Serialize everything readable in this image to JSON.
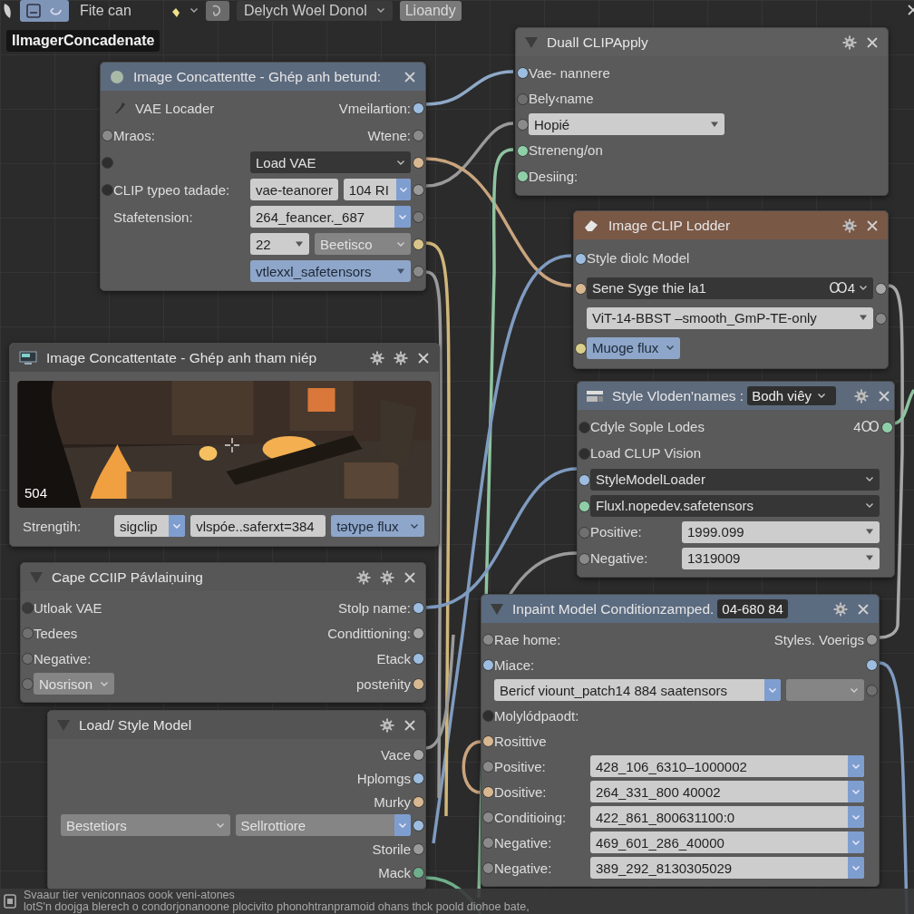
{
  "toolbar": {
    "file_label": "Fite can",
    "dropdown": "Delych Woel Donol",
    "button": "Lioandy"
  },
  "canvas_label": "IlmagerConcadenate",
  "nodes": [
    {
      "title": "Image Concattentte - Ghép anh betund:",
      "color": "#5c6a7e",
      "rows": [
        {
          "kind": "tool",
          "left": "VAE Locader",
          "right": "Vmeilartion:",
          "out": {
            "color": "#9dbde0"
          }
        },
        {
          "kind": "io",
          "left": "Mraos:",
          "right": "Wtene:",
          "in": {
            "color": "#8a8a8a"
          },
          "out": {
            "color": "#8a8a8a"
          }
        },
        {
          "kind": "widgets",
          "widgets": [
            {
              "value": "Load VAE"
            }
          ],
          "in": {
            "color": "#2e2e2e"
          },
          "out": {
            "color": "#d8b891"
          }
        },
        {
          "kind": "widgets",
          "label": "CLIP typeo tadade:",
          "widgets": [
            {
              "value": "vae-teanorer"
            },
            {
              "value": "104  RI"
            }
          ],
          "in": {
            "color": "#2e2e2e"
          },
          "out": {
            "color": "#9a9a9a"
          }
        },
        {
          "kind": "widgets",
          "label": "Stafetension:",
          "widgets": [
            {
              "value": "264_feancer._687"
            }
          ],
          "out": {
            "color": "#7a7a7a"
          }
        },
        {
          "kind": "widgets",
          "widgets": [
            {
              "value": "22"
            },
            {
              "value": "Beetisco"
            }
          ],
          "out": {
            "color": "#d8c48a"
          }
        },
        {
          "kind": "widgets",
          "widgets": [
            {
              "value": "vtlexxl_safetensors"
            }
          ],
          "out": {
            "color": "#8a8a8a"
          }
        }
      ]
    },
    {
      "title": "Duall CLIPApply",
      "color": "#5e5e5e",
      "rows": [
        {
          "kind": "io",
          "left": "Vae- nannere",
          "in": {
            "color": "#9dbde0"
          }
        },
        {
          "kind": "io",
          "left": "Bely‹name",
          "in": {
            "color": "#6f6f6f"
          }
        },
        {
          "kind": "widgets",
          "widgets": [
            {
              "value": "Hopié"
            }
          ],
          "in": {
            "color": "#8a8a8a"
          }
        },
        {
          "kind": "io",
          "left": "Streneng/on",
          "in": {
            "color": "#8fcfa8"
          }
        },
        {
          "kind": "io",
          "left": "Desiing:",
          "in": {
            "color": "#8fcfa8"
          }
        }
      ]
    },
    {
      "title": "Image CLIP Lodder",
      "color": "#7a5846",
      "rows": [
        {
          "kind": "io",
          "left": "Style diolc Model",
          "in": {
            "color": "#9dbde0"
          }
        },
        {
          "kind": "widgets",
          "widgets": [
            {
              "value": "Sene Syge thie la1",
              "suffix": "Ꝏ4"
            }
          ],
          "in": {
            "color": "#d8b891"
          },
          "out": {
            "color": "#a8a8a8"
          }
        },
        {
          "kind": "widgets",
          "widgets": [
            {
              "value": "ViT-14-BBST –smooth_GmP-TE-only"
            }
          ],
          "out": {
            "color": "#8a8a8a"
          }
        },
        {
          "kind": "widgets",
          "widgets": [
            {
              "value": "Muoge  flux"
            }
          ],
          "in": {
            "color": "#d8cf8a"
          }
        }
      ]
    },
    {
      "title": "Image Concattentate - Ghép anh tham niép",
      "color": "#4a4a4a",
      "rows": [
        {
          "kind": "picture",
          "caption": "504"
        },
        {
          "kind": "widgets",
          "label": "Strengtih:",
          "widgets": [
            {
              "value": "sigclip"
            },
            {
              "value": "vlspóe..saferxt=384"
            },
            {
              "value": "tətype  flux"
            }
          ]
        }
      ]
    },
    {
      "title": "Style Vloden'names :",
      "badge": "Bodh viêy",
      "color": "#5d6a7c",
      "rows": [
        {
          "kind": "io",
          "left": "Cdyle Sople Lodes",
          "right": "4Ꝏ",
          "in": {
            "color": "#2e2e2e"
          },
          "out": {
            "color": "#8fcfa8"
          }
        },
        {
          "kind": "io",
          "left": "Load CLUP Vision",
          "in": {
            "color": "#2e2e2e"
          }
        },
        {
          "kind": "widgets",
          "widgets": [
            {
              "value": "StyleModelLoader"
            }
          ],
          "in": {
            "color": "#9dbde0"
          }
        },
        {
          "kind": "widgets",
          "widgets": [
            {
              "value": "Fluxl.nopedev.safetensors"
            }
          ],
          "in": {
            "color": "#8fcfa8"
          }
        },
        {
          "kind": "widgets",
          "label": "Positive:",
          "widgets": [
            {
              "value": "1999.099"
            }
          ],
          "in": {
            "color": "#6f6f6f"
          }
        },
        {
          "kind": "widgets",
          "label": "Negative:",
          "widgets": [
            {
              "value": "1319009"
            }
          ],
          "in": {
            "color": "#8a8a8a"
          }
        }
      ]
    },
    {
      "title": "Cape CCIIP Pávlaiṇuing",
      "color": "#575757",
      "rows": [
        {
          "kind": "io",
          "left": "Utloak VAE",
          "right": "Stolp name:",
          "in": {
            "color": "#3a3a3a"
          },
          "out": {
            "color": "#9dbde0"
          }
        },
        {
          "kind": "io",
          "left": "Tedees",
          "right": "Condittioning:",
          "in": {
            "color": "#6f6f6f"
          },
          "out": {
            "color": "#a8a8a8"
          }
        },
        {
          "kind": "io",
          "left": "Negative:",
          "right": "Etack",
          "in": {
            "color": "#6f6f6f"
          },
          "out": {
            "color": "#9dbde0"
          }
        },
        {
          "kind": "widgets",
          "widgets": [
            {
              "value": "Nosrison"
            }
          ],
          "right": "posteṅity",
          "in": {
            "color": "#6f6f6f"
          },
          "out": {
            "color": "#d8b891"
          }
        }
      ]
    },
    {
      "title": "Load/ Style Model",
      "color": "#545454",
      "rows": [
        {
          "kind": "io",
          "right": "Vace",
          "out": {
            "color": "#a8a8a8"
          }
        },
        {
          "kind": "io",
          "right": "Hplomgs",
          "out": {
            "color": "#9dbde0"
          }
        },
        {
          "kind": "io",
          "right": "Murky",
          "out": {
            "color": "#d8b891"
          }
        },
        {
          "kind": "widgets",
          "widgets": [
            {
              "value": "Bestetiors"
            },
            {
              "value": "Sellrottiore"
            }
          ],
          "out": {
            "color": "#9dbde0"
          }
        },
        {
          "kind": "io",
          "right": "Storile",
          "out": {
            "color": "#9a9a9a"
          }
        },
        {
          "kind": "io",
          "right": "Mack",
          "out": {
            "color": "#6fae8a"
          }
        }
      ]
    },
    {
      "title": "Inpaint Model Conditionzamped.",
      "badge": "04-680  84",
      "color": "#5b6b80",
      "rows": [
        {
          "kind": "io",
          "left": "Rae home:",
          "right": "Styles. Voerigs",
          "in": {
            "color": "#8a8a8a"
          },
          "out": {
            "color": "#9a9a9a"
          }
        },
        {
          "kind": "io",
          "left": "Miace:",
          "in": {
            "color": "#9dbde0"
          },
          "out": {
            "color": "#9dbde0"
          }
        },
        {
          "kind": "widgets",
          "widgets": [
            {
              "value": "Bericf viount_patch14  884 saatensors"
            }
          ],
          "out": {
            "color": "#6f6f6f"
          }
        },
        {
          "kind": "io",
          "left": "Molylódpaodt:",
          "in": {
            "color": "#2e2e2e"
          }
        },
        {
          "kind": "io",
          "left": "Rosittive",
          "in": {
            "color": "#d8b891"
          }
        },
        {
          "kind": "widgets",
          "label": "Positive:",
          "widgets": [
            {
              "value": "428_106_6310–1000002"
            }
          ],
          "in": {
            "color": "#8a8a8a"
          }
        },
        {
          "kind": "widgets",
          "label": "Dositive:",
          "widgets": [
            {
              "value": "264_331_800  40002"
            }
          ],
          "in": {
            "color": "#d8b891"
          }
        },
        {
          "kind": "widgets",
          "label": "Conditioing:",
          "widgets": [
            {
              "value": "422_861_800631100:0"
            }
          ],
          "in": {
            "color": "#8a8a8a"
          }
        },
        {
          "kind": "widgets",
          "label": "Negative:",
          "widgets": [
            {
              "value": "469_601_286_40000"
            }
          ],
          "in": {
            "color": "#8a8a8a"
          }
        },
        {
          "kind": "widgets",
          "label": "Negative:",
          "widgets": [
            {
              "value": "389_292_8130305029"
            }
          ],
          "in": {
            "color": "#8a8a8a"
          }
        }
      ]
    }
  ],
  "status_bar": {
    "lines": [
      "Svaaur tier veniconnaos oook veni-atones",
      "lotS'n doojga blerech o condorjonanoone plocivito phonohtranpramoid ohans thck poold diohoe bate,"
    ]
  }
}
